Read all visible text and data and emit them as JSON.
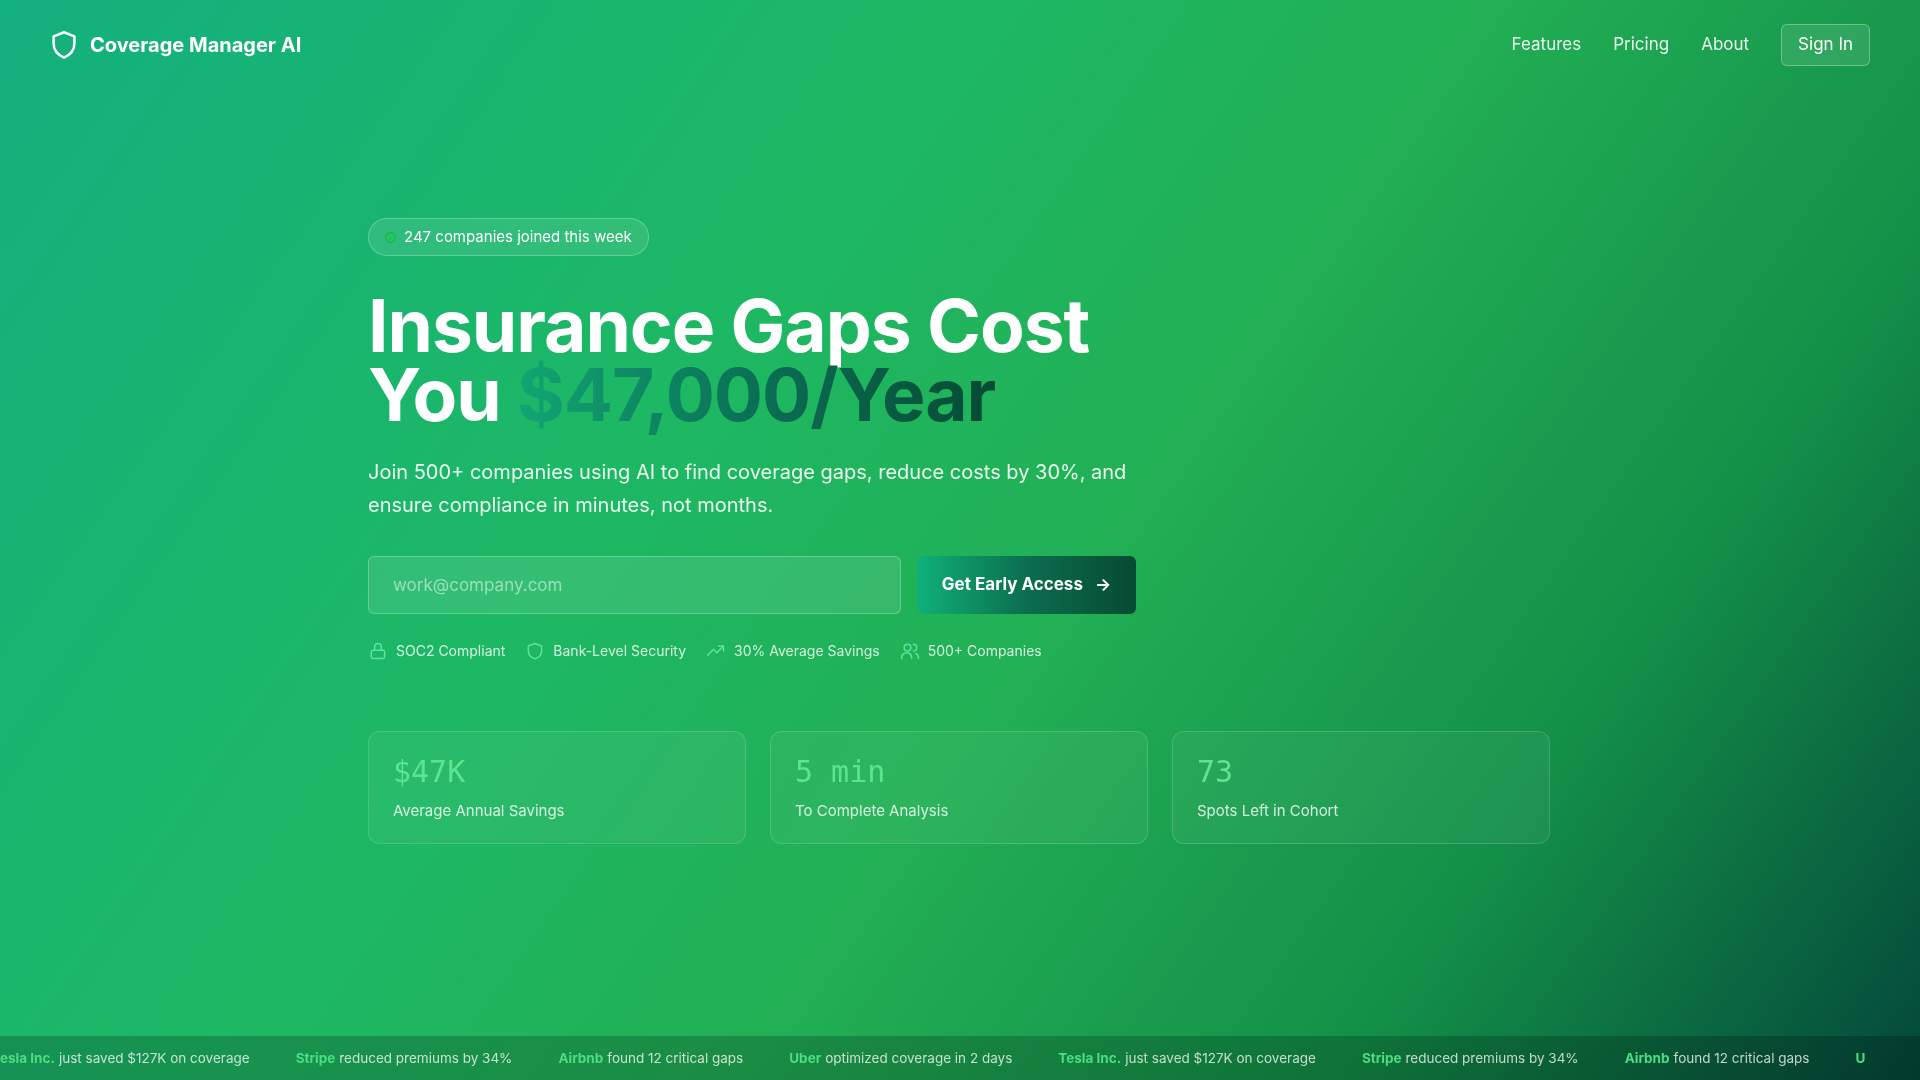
{
  "header": {
    "brand": "Coverage Manager AI",
    "nav": [
      "Features",
      "Pricing",
      "About"
    ],
    "sign_in": "Sign In"
  },
  "hero": {
    "badge": "247 companies joined this week",
    "title_line1": "Insurance Gaps Cost",
    "title_line2_start": "You",
    "title_highlight": "$47,000/Year",
    "subtitle": "Join 500+ companies using AI to find coverage gaps, reduce costs by 30%, and ensure compliance in minutes, not months.",
    "email": {
      "placeholder": "work@company.com"
    },
    "cta": "Get Early Access",
    "cta_arrow": "→",
    "trust": [
      "SOC2 Compliant",
      "Bank-Level Security",
      "30% Average Savings",
      "500+ Companies"
    ]
  },
  "stats": [
    {
      "value": "$47K",
      "label": "Average Annual Savings"
    },
    {
      "value": "5 min",
      "label": "To Complete Analysis"
    },
    {
      "value": "73",
      "label": "Spots Left in Cohort"
    }
  ],
  "ticker": [
    {
      "company": "esla Inc.",
      "text": "just saved $127K on coverage"
    },
    {
      "company": "Stripe",
      "text": "reduced premiums by 34%"
    },
    {
      "company": "Airbnb",
      "text": "found 12 critical gaps"
    },
    {
      "company": "Uber",
      "text": "optimized coverage in 2 days"
    },
    {
      "company": "Tesla Inc.",
      "text": "just saved $127K on coverage"
    },
    {
      "company": "Stripe",
      "text": "reduced premiums by 34%"
    },
    {
      "company": "Airbnb",
      "text": "found 12 critical gaps"
    },
    {
      "company": "U"
    }
  ]
}
